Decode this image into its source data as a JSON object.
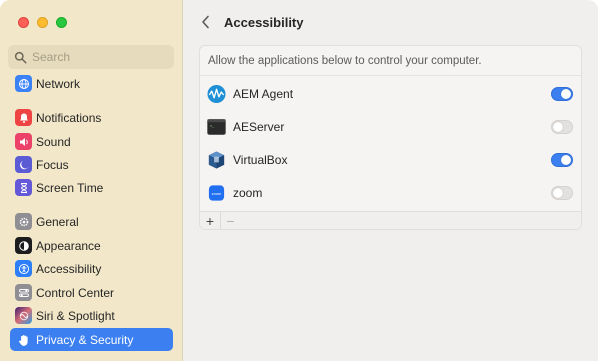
{
  "window": {
    "traffic_lights": [
      "close",
      "minimize",
      "zoom"
    ]
  },
  "search": {
    "placeholder": "Search"
  },
  "sidebar": {
    "items": [
      {
        "label": "Network",
        "icon": "globe-icon",
        "color": "#3b82f6"
      },
      {
        "label": "Notifications",
        "icon": "bell-icon",
        "color": "#ef4444"
      },
      {
        "label": "Sound",
        "icon": "speaker-icon",
        "color": "#ec4269"
      },
      {
        "label": "Focus",
        "icon": "moon-icon",
        "color": "#5b5bd6"
      },
      {
        "label": "Screen Time",
        "icon": "hourglass-icon",
        "color": "#6457d8"
      },
      {
        "label": "General",
        "icon": "gear-icon",
        "color": "#8e8e93"
      },
      {
        "label": "Appearance",
        "icon": "appearance-icon",
        "color": "#1c1c1e"
      },
      {
        "label": "Accessibility",
        "icon": "accessibility-icon",
        "color": "#2d7ff9"
      },
      {
        "label": "Control Center",
        "icon": "control-center-icon",
        "color": "#8e8e93"
      },
      {
        "label": "Siri & Spotlight",
        "icon": "siri-icon",
        "color": "#7a3bd9"
      },
      {
        "label": "Privacy & Security",
        "icon": "hand-icon",
        "color": "#3b7ff0",
        "selected": true
      }
    ]
  },
  "header": {
    "title": "Accessibility"
  },
  "panel": {
    "description": "Allow the applications below to control your computer.",
    "apps": [
      {
        "name": "AEM Agent",
        "icon": "aem-agent-icon",
        "enabled": true
      },
      {
        "name": "AEServer",
        "icon": "terminal-icon",
        "enabled": false
      },
      {
        "name": "VirtualBox",
        "icon": "virtualbox-icon",
        "enabled": true
      },
      {
        "name": "zoom",
        "icon": "zoom-icon",
        "enabled": false
      }
    ],
    "add_label": "+",
    "remove_label": "−"
  }
}
